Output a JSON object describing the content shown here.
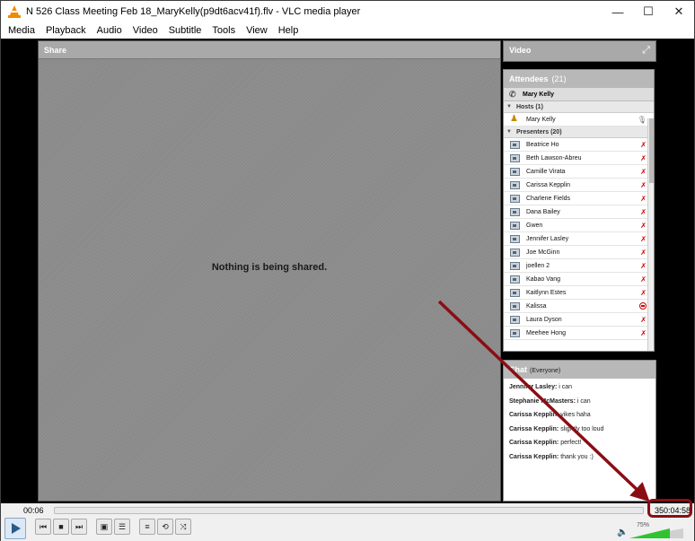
{
  "window": {
    "title": "N 526 Class Meeting Feb 18_MaryKelly(p9dt6acv41f).flv - VLC media player",
    "controls": {
      "minimize": "—",
      "maximize": "☐",
      "close": "✕"
    }
  },
  "menu": [
    "Media",
    "Playback",
    "Audio",
    "Video",
    "Subtitle",
    "Tools",
    "View",
    "Help"
  ],
  "share": {
    "label": "Share",
    "message": "Nothing is being shared."
  },
  "video_panel": {
    "label": "Video",
    "expand_icon": "⤢"
  },
  "attendees": {
    "label": "Attendees",
    "count": "(21)",
    "me": "Mary Kelly",
    "hosts_label": "Hosts (1)",
    "hosts": [
      {
        "name": "Mary Kelly",
        "status": "mic"
      }
    ],
    "presenters_label": "Presenters (20)",
    "presenters": [
      {
        "name": "Beatrice Ho",
        "status": "muted"
      },
      {
        "name": "Beth Lawson-Abreu",
        "status": "muted"
      },
      {
        "name": "Camille Virata",
        "status": "muted"
      },
      {
        "name": "Carissa Kepplin",
        "status": "muted"
      },
      {
        "name": "Charlene Fields",
        "status": "muted"
      },
      {
        "name": "Dana Bailey",
        "status": "muted"
      },
      {
        "name": "Gwen",
        "status": "muted"
      },
      {
        "name": "Jennifer Lasley",
        "status": "muted"
      },
      {
        "name": "Joe McGinn",
        "status": "muted"
      },
      {
        "name": "joellen 2",
        "status": "muted"
      },
      {
        "name": "Kabao Vang",
        "status": "muted"
      },
      {
        "name": "Kaitlynn Estes",
        "status": "muted"
      },
      {
        "name": "Kalissa",
        "status": "blocked"
      },
      {
        "name": "Laura Dyson",
        "status": "muted"
      },
      {
        "name": "Meehee Hong",
        "status": "muted"
      }
    ]
  },
  "chat": {
    "label": "Chat",
    "scope": "(Everyone)",
    "messages": [
      {
        "who": "Jennifer Lasley:",
        "text": " i can"
      },
      {
        "who": "Stephanie McMasters:",
        "text": " i can"
      },
      {
        "who": "Carissa Kepplin:",
        "text": " yikes haha"
      },
      {
        "who": "Carissa Kepplin:",
        "text": " slightly too loud"
      },
      {
        "who": "Carissa Kepplin:",
        "text": " perfect!"
      },
      {
        "who": "Carissa Kepplin:",
        "text": " thank you :)"
      }
    ]
  },
  "player": {
    "current_time": "00:06",
    "total_time": "350:04:58",
    "volume": "75%",
    "volume_level": 0.75,
    "buttons": [
      "play",
      "previous",
      "stop",
      "next",
      "fullscreen",
      "extended-settings",
      "playlist",
      "loop",
      "random"
    ]
  },
  "annotation_color": "#8b0d14"
}
